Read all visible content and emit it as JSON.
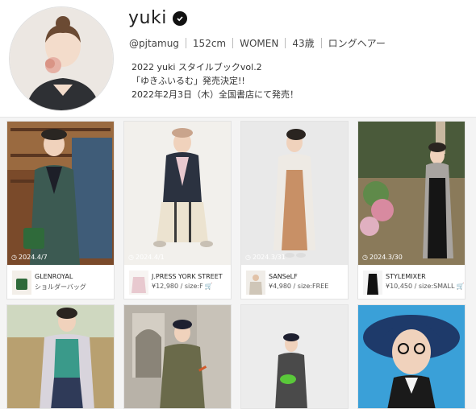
{
  "profile": {
    "name": "yuki",
    "handle": "@pjtamug",
    "height": "152cm",
    "gender": "WOMEN",
    "age": "43歳",
    "hair": "ロングヘアー",
    "bio_lines": [
      "2022 yuki スタイルブックvol.2",
      "「ゆきふいるむ」発売決定!!",
      "2022年2月3日（木）全国書店にて発売！"
    ]
  },
  "posts": [
    {
      "date": "2024.4/7",
      "brand": "GLENROYAL",
      "sub": "ショルダーバッグ",
      "cart": false
    },
    {
      "date": "2024.4/1",
      "brand": "J.PRESS YORK STREET",
      "sub": "¥12,980 / size:F",
      "cart": true
    },
    {
      "date": "2024.3/31",
      "brand": "SANSeLF",
      "sub": "¥4,980 / size:FREE",
      "cart": false
    },
    {
      "date": "2024.3/30",
      "brand": "STYLEMIXER",
      "sub": "¥10,450 / size:SMALL",
      "cart": true
    }
  ],
  "colors": {
    "verified": "#111111",
    "cart": "#3a7bd5"
  }
}
